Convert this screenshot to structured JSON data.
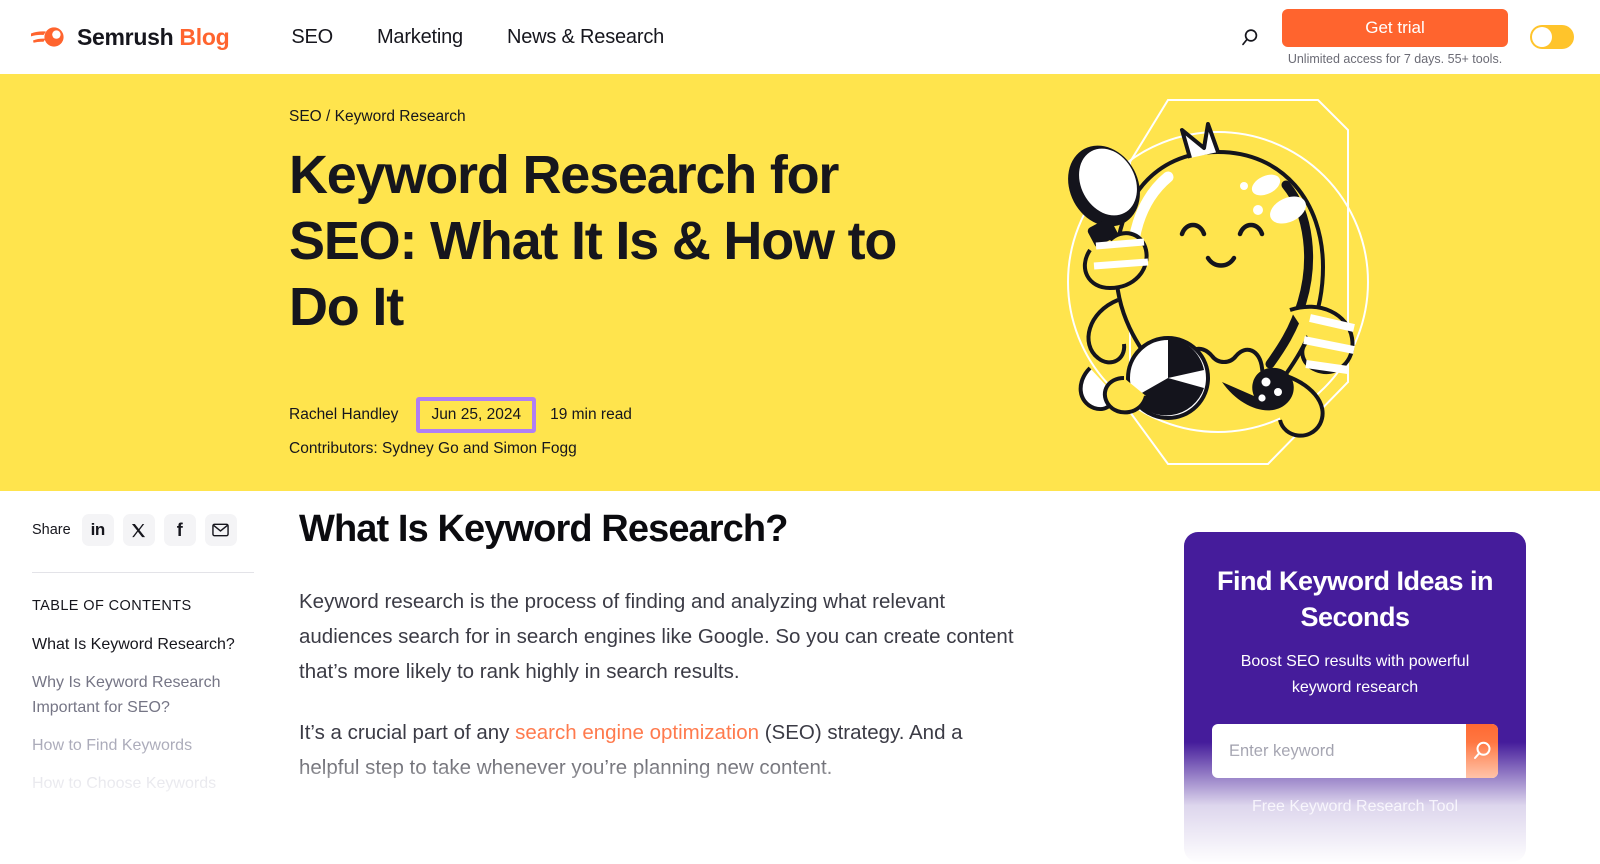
{
  "header": {
    "brand": {
      "name": "Semrush",
      "suffix": "Blog"
    },
    "nav": [
      {
        "label": "SEO"
      },
      {
        "label": "Marketing"
      },
      {
        "label": "News & Research"
      }
    ],
    "search_icon": "search-icon",
    "cta": {
      "label": "Get trial",
      "subtext": "Unlimited access for 7 days. 55+ tools."
    },
    "toggle": {
      "state": "off"
    },
    "accent_color": "#ff642e"
  },
  "hero": {
    "background_color": "#ffe44d",
    "breadcrumb": {
      "parent": "SEO",
      "separator": "/",
      "current": "Keyword Research"
    },
    "title": "Keyword Research for SEO: What It Is & How to Do It",
    "meta": {
      "author": "Rachel Handley",
      "date": "Jun 25, 2024",
      "read_time": "19 min read",
      "contributors": "Contributors: Sydney Go and Simon Fogg"
    },
    "annotation": {
      "target": "date",
      "border_color": "#b07ef5"
    },
    "illustration": "octopus-with-magnifying-glass-illustration"
  },
  "rail": {
    "share_label": "Share",
    "share_buttons": [
      {
        "name": "linkedin-icon",
        "glyph": "in"
      },
      {
        "name": "x-twitter-icon",
        "glyph": "𝕏"
      },
      {
        "name": "facebook-icon",
        "glyph": "f"
      },
      {
        "name": "email-icon",
        "glyph": "✉"
      }
    ],
    "toc_title": "TABLE OF CONTENTS",
    "toc_items": [
      {
        "label": "What Is Keyword Research?",
        "state": "active"
      },
      {
        "label": "Why Is Keyword Research Important for SEO?",
        "state": "l1"
      },
      {
        "label": "How to Find Keywords",
        "state": "l2"
      },
      {
        "label": "How to Choose Keywords",
        "state": "l3"
      }
    ]
  },
  "article": {
    "heading": "What Is Keyword Research?",
    "paragraph_1": "Keyword research is the process of finding and analyzing what relevant audiences search for in search engines like Google. So you can create content that’s more likely to rank highly in search results.",
    "paragraph_2_pre": "It’s a crucial part of any ",
    "paragraph_2_link": "search engine optimization",
    "paragraph_2_post": " (SEO) strategy. And a helpful step to take whenever you’re planning new content."
  },
  "side_card": {
    "background_color": "#451c9b",
    "title": "Find Keyword Ideas in Seconds",
    "subtitle": "Boost SEO results with powerful keyword research",
    "input_placeholder": "Enter keyword",
    "input_value": "",
    "submit_icon": "search-icon",
    "footer_note": "Free Keyword Research Tool"
  }
}
